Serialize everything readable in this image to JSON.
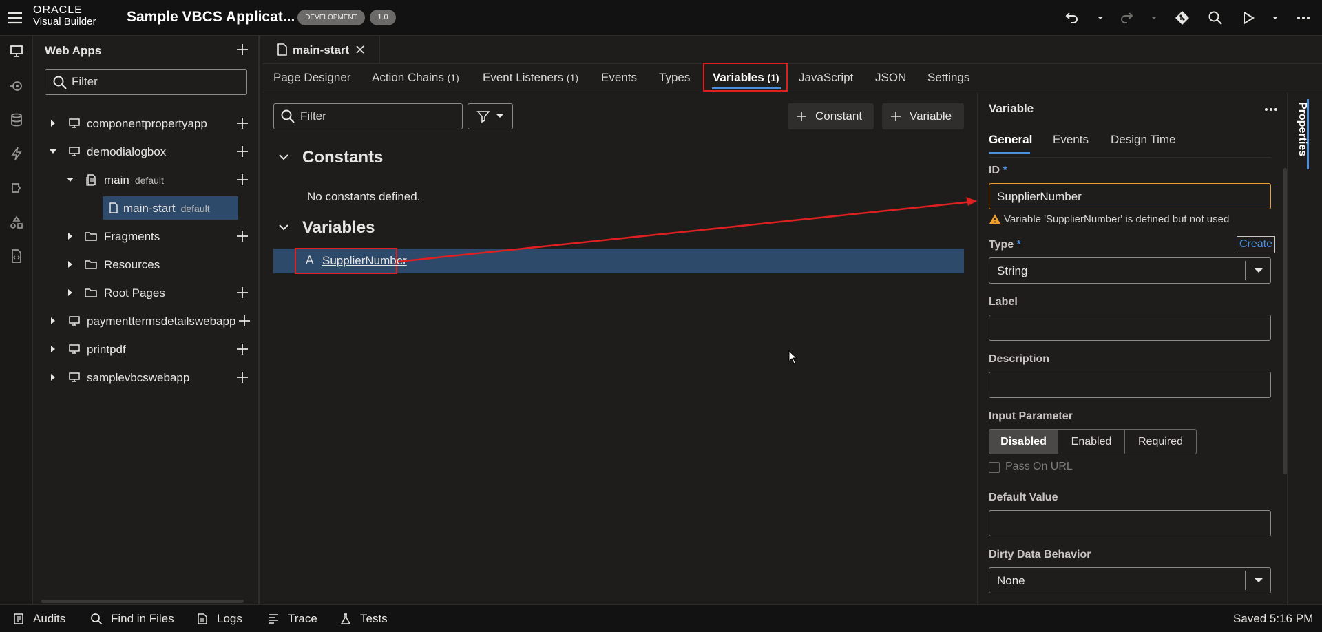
{
  "header": {
    "logo_line1": "ORACLE",
    "logo_line2": "Visual Builder",
    "app_title": "Sample VBCS Applicat...",
    "env_badge": "DEVELOPMENT",
    "version_badge": "1.0"
  },
  "navigator": {
    "title": "Web Apps",
    "filter_placeholder": "Filter",
    "items": [
      {
        "label": "componentpropertyapp",
        "sub": ""
      },
      {
        "label": "demodialogbox",
        "sub": ""
      },
      {
        "label": "main",
        "sub": "default"
      },
      {
        "label": "main-start",
        "sub": "default"
      },
      {
        "label": "Fragments",
        "sub": ""
      },
      {
        "label": "Resources",
        "sub": ""
      },
      {
        "label": "Root Pages",
        "sub": ""
      },
      {
        "label": "paymenttermsdetailswebapp",
        "sub": ""
      },
      {
        "label": "printpdf",
        "sub": ""
      },
      {
        "label": "samplevbcswebapp",
        "sub": ""
      }
    ]
  },
  "editor": {
    "file_tab": "main-start",
    "tabs": [
      {
        "label": "Page Designer",
        "count": ""
      },
      {
        "label": "Action Chains",
        "count": "(1)"
      },
      {
        "label": "Event Listeners",
        "count": "(1)"
      },
      {
        "label": "Events",
        "count": ""
      },
      {
        "label": "Types",
        "count": ""
      },
      {
        "label": "Variables",
        "count": "(1)"
      },
      {
        "label": "JavaScript",
        "count": ""
      },
      {
        "label": "JSON",
        "count": ""
      },
      {
        "label": "Settings",
        "count": ""
      }
    ],
    "filter_placeholder": "Filter",
    "constant_button": "Constant",
    "variable_button": "Variable",
    "constants_heading": "Constants",
    "no_constants": "No constants defined.",
    "variables_heading": "Variables",
    "variable_name": "SupplierNumber",
    "variable_type_glyph": "A"
  },
  "properties": {
    "panel_title": "Variable",
    "side_tab": "Properties",
    "tabs": [
      "General",
      "Events",
      "Design Time"
    ],
    "id_label": "ID",
    "required_mark": "*",
    "id_value": "SupplierNumber",
    "warning": "Variable 'SupplierNumber' is defined but not used",
    "type_label": "Type",
    "create_link": "Create",
    "type_value": "String",
    "label_label": "Label",
    "label_value": "",
    "description_label": "Description",
    "description_value": "",
    "input_param_label": "Input Parameter",
    "input_param_options": [
      "Disabled",
      "Enabled",
      "Required"
    ],
    "pass_on_url": "Pass On URL",
    "default_value_label": "Default Value",
    "default_value": "",
    "dirty_label": "Dirty Data Behavior",
    "dirty_value": "None"
  },
  "statusbar": {
    "audits": "Audits",
    "find": "Find in Files",
    "logs": "Logs",
    "trace": "Trace",
    "tests": "Tests",
    "saved": "Saved 5:16 PM"
  },
  "colors": {
    "accent_blue": "#4a8fe0",
    "selected_row": "#2d4a6b",
    "annotation_red": "#e02020",
    "warning": "#f0a030"
  }
}
